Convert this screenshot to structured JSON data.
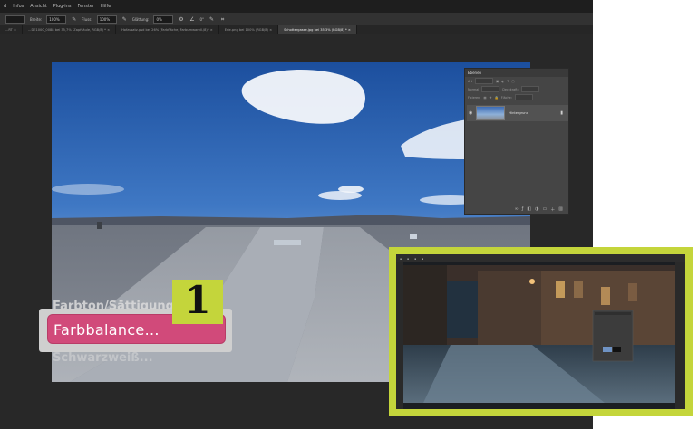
{
  "menubar": {
    "items": [
      "d",
      "Infos",
      "Ansicht",
      "Plug-ins",
      "Fenster",
      "Hilfe"
    ]
  },
  "options": {
    "breite_label": "Breite:",
    "breite_value": "100%",
    "fluss_label": "Fluss:",
    "fluss_value": "100%",
    "glaettung_label": "Glättung:",
    "glaettung_value": "0%",
    "winkel_value": "0°"
  },
  "tabs": [
    {
      "label": "...RT ×",
      "active": false
    },
    {
      "label": "...DE1000_0088 bei 35,7% (Zapfsäule, RGB/8) * ×",
      "active": false
    },
    {
      "label": "Hofzusatz.psd bei 26% (Farbfläche, Farbumwandl./8)* ×",
      "active": false
    },
    {
      "label": "Erle.png bei 100% (RGB/8) ×",
      "active": false
    },
    {
      "label": "Schottergasse.jpg bei 35,3% (RGB/8) * ×",
      "active": true
    }
  ],
  "layers_panel": {
    "title": "Ebenen",
    "kind_label": "Art",
    "mode_label": "Normal",
    "opacity_label": "Deckkraft:",
    "lock_label": "Fixieren:",
    "fill_label": "Fläche:",
    "layer_name": "Hintergrund"
  },
  "menu": {
    "prev_item": "Farbton/Sättigung ...",
    "selected_item": "Farbbalance...",
    "next_item": "Schwarzweiß..."
  },
  "badge": {
    "number": "1"
  },
  "colors": {
    "accent_green": "#c4d53b",
    "menu_highlight": "#d14a7a"
  }
}
